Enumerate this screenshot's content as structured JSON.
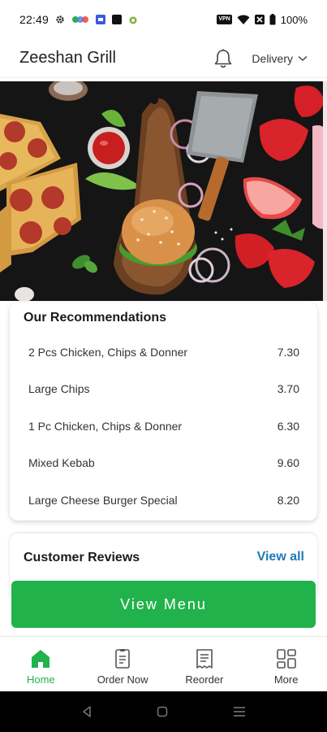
{
  "status_bar": {
    "time": "22:49",
    "vpn": "VPN",
    "battery": "100%"
  },
  "header": {
    "title": "Zeeshan Grill",
    "delivery_label": "Delivery"
  },
  "recommendations": {
    "title": "Our Recommendations",
    "items": [
      {
        "name": "2 Pcs Chicken, Chips & Donner",
        "price": "7.30"
      },
      {
        "name": "Large Chips",
        "price": "3.70"
      },
      {
        "name": "1 Pc Chicken, Chips & Donner",
        "price": "6.30"
      },
      {
        "name": "Mixed Kebab",
        "price": "9.60"
      },
      {
        "name": "Large Cheese Burger Special",
        "price": "8.20"
      }
    ]
  },
  "reviews": {
    "title": "Customer Reviews",
    "view_all_label": "View all"
  },
  "view_menu_label": "View Menu",
  "bottom_nav": {
    "items": [
      {
        "label": "Home",
        "icon": "home-icon",
        "active": true
      },
      {
        "label": "Order Now",
        "icon": "order-icon",
        "active": false
      },
      {
        "label": "Reorder",
        "icon": "receipt-icon",
        "active": false
      },
      {
        "label": "More",
        "icon": "grid-icon",
        "active": false
      }
    ]
  },
  "colors": {
    "accent_green": "#22b24c",
    "link_blue": "#1f7ab8"
  }
}
